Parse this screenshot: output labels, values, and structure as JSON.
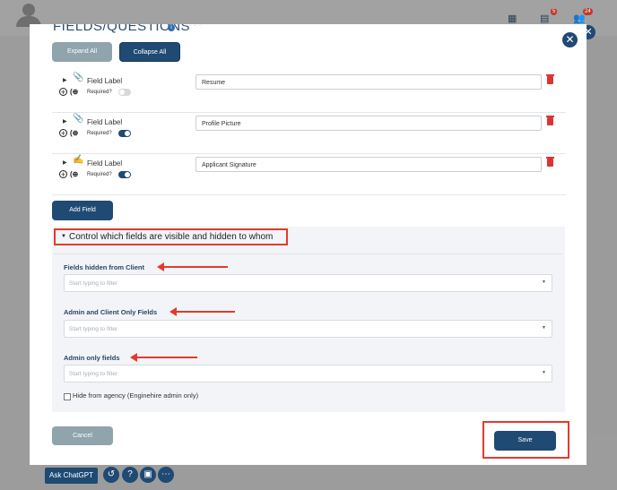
{
  "background": {
    "badges": [
      "5",
      "24"
    ]
  },
  "modal": {
    "title": "FIELDS/QUESTIONS",
    "title_suffix": "· · · ·",
    "expand_all": "Expand All",
    "collapse_all": "Collapse All",
    "fields": [
      {
        "label": "Field Label",
        "required_label": "Required?",
        "required": false,
        "value": "Resume",
        "icon": "paperclip-icon"
      },
      {
        "label": "Field Label",
        "required_label": "Required?",
        "required": true,
        "value": "Profile Picture",
        "icon": "paperclip-icon"
      },
      {
        "label": "Field Label",
        "required_label": "Required?",
        "required": true,
        "value": "Applicant Signature",
        "icon": "signature-icon"
      }
    ],
    "add_field": "Add Field",
    "visibility": {
      "title": "Control which fields are visible and hidden to whom",
      "filters": [
        {
          "label": "Fields hidden from Client",
          "placeholder": "Start typing to filter"
        },
        {
          "label": "Admin and Client Only Fields",
          "placeholder": "Start typing to filter"
        },
        {
          "label": "Admin only fields",
          "placeholder": "Start typing to filter"
        }
      ],
      "hide_from_agency": "Hide from agency (Enginehire admin only)"
    },
    "cancel": "Cancel",
    "save": "Save"
  },
  "bottom_bar": {
    "chatgpt": "Ask ChatGPT"
  },
  "colors": {
    "primary": "#1f4a73",
    "secondary": "#8fa4ac",
    "highlight": "#e23b2c",
    "danger": "#dd3333"
  }
}
